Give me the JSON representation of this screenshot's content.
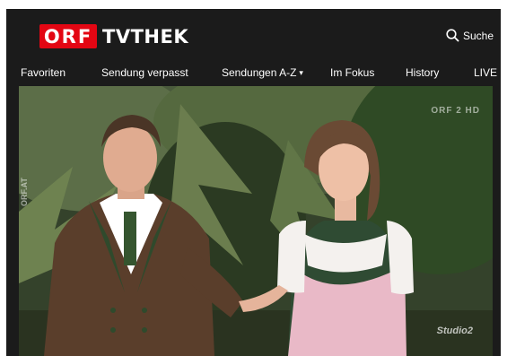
{
  "header": {
    "logo_mark": "ORF",
    "logo_text": "TVTHEK",
    "search_label": "Suche",
    "search_icon": "search-icon",
    "brand_red": "#e30613",
    "background": "#1b1b1b"
  },
  "nav": {
    "items": [
      {
        "label": "Favoriten"
      },
      {
        "label": "Sendung verpasst"
      },
      {
        "label": "Sendungen A-Z"
      },
      {
        "label": "Im Fokus"
      },
      {
        "label": "History"
      },
      {
        "label": "LIVE"
      }
    ],
    "dropdown_caret": "▾"
  },
  "player": {
    "watermark_top": "ORF 2 HD",
    "watermark_side": "ORF.AT",
    "watermark_bottom": "Studio2"
  }
}
